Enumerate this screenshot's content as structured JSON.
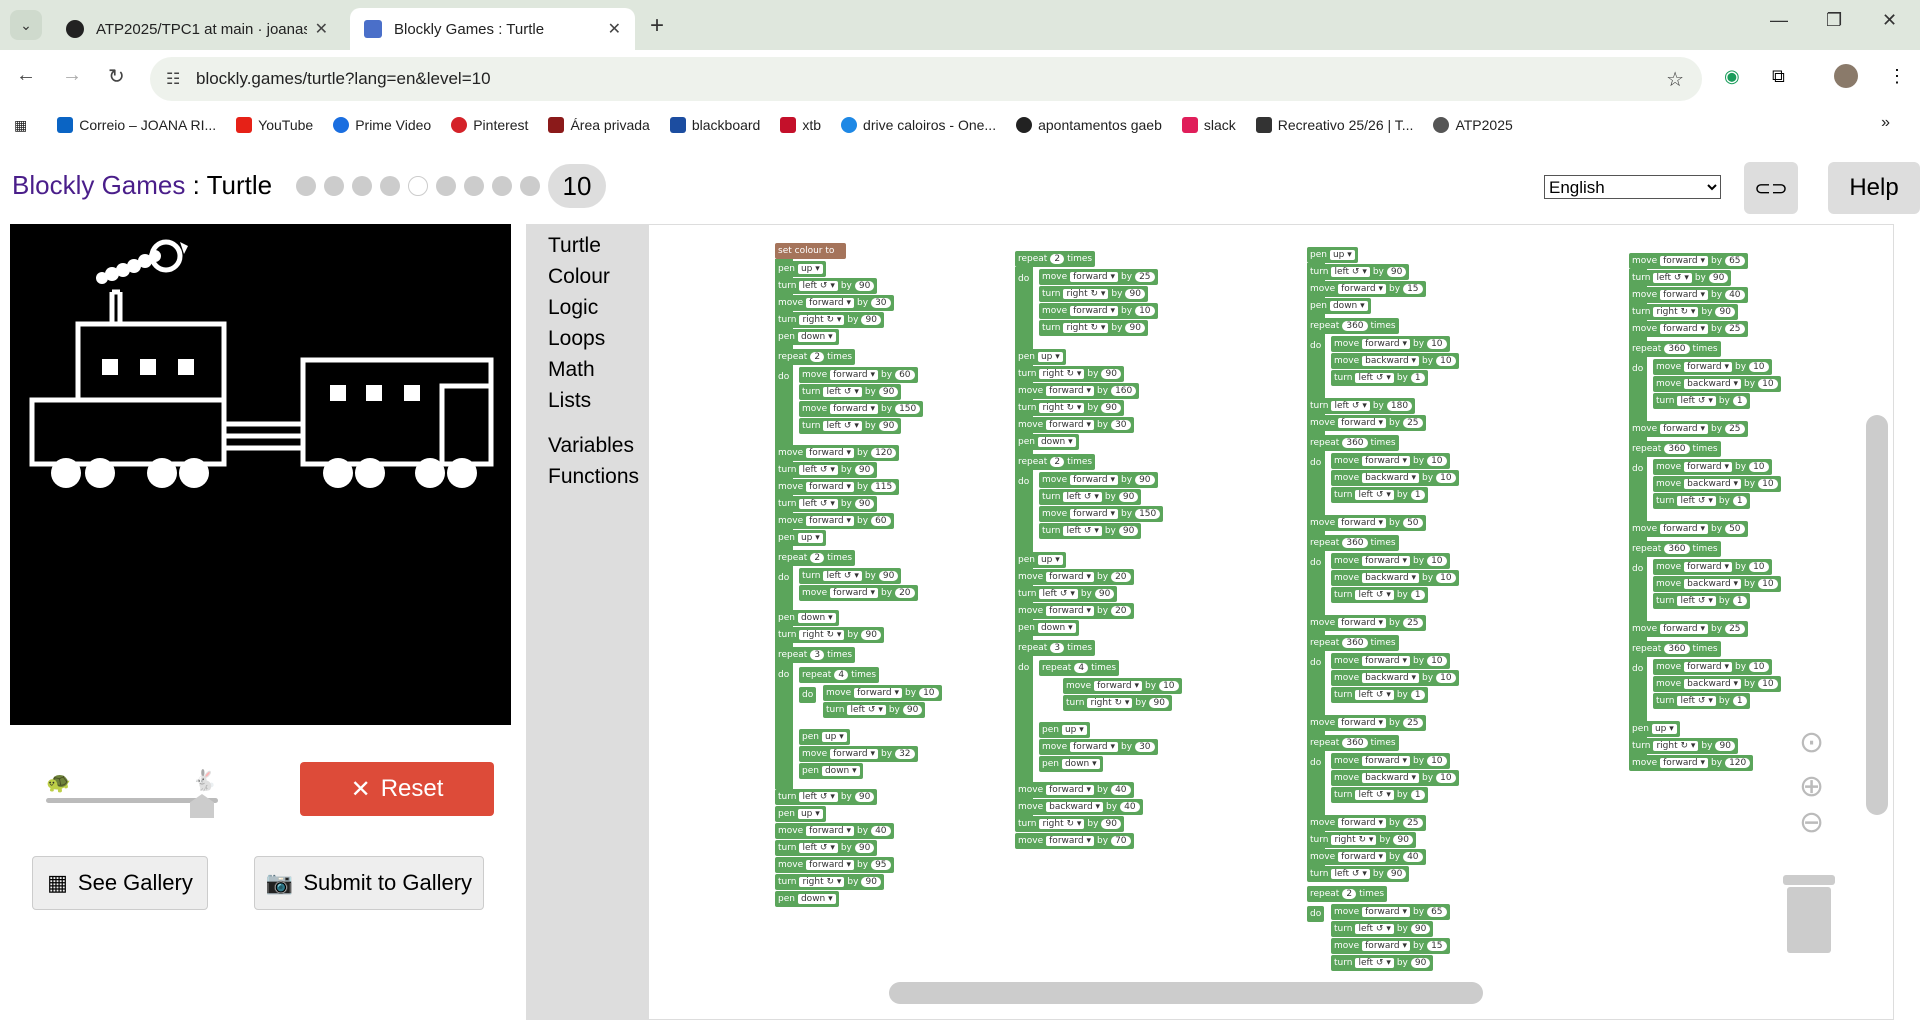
{
  "browser": {
    "tabs": [
      {
        "title": "ATP2025/TPC1 at main · joanasc",
        "active": false
      },
      {
        "title": "Blockly Games : Turtle",
        "active": true
      }
    ],
    "url": "blockly.games/turtle?lang=en&level=10",
    "bookmarks": [
      "Correio – JOANA RI...",
      "YouTube",
      "Prime Video",
      "Pinterest",
      "Área privada",
      "blackboard",
      "xtb",
      "drive caloiros - One...",
      "apontamentos gaeb",
      "slack",
      "Recreativo 25/26 | T...",
      "ATP2025"
    ]
  },
  "header": {
    "brand": "Blockly Games",
    "separator": " : ",
    "game": "Turtle",
    "level": "10",
    "language": "English",
    "help_label": "Help"
  },
  "controls": {
    "reset_label": "Reset",
    "see_gallery_label": "See Gallery",
    "submit_gallery_label": "Submit to Gallery"
  },
  "toolbox": {
    "categories": [
      "Turtle",
      "Colour",
      "Logic",
      "Loops",
      "Math",
      "Lists"
    ],
    "categories2": [
      "Variables",
      "Functions"
    ]
  },
  "blocks": {
    "set_colour": "set colour to",
    "pen": "pen",
    "turn": "turn",
    "move": "move",
    "repeat": "repeat",
    "times": "times",
    "do": "do",
    "by": "by",
    "up": "up",
    "down": "down",
    "forward": "forward",
    "backward": "backward",
    "left": "left ↺",
    "right": "right ↻"
  }
}
